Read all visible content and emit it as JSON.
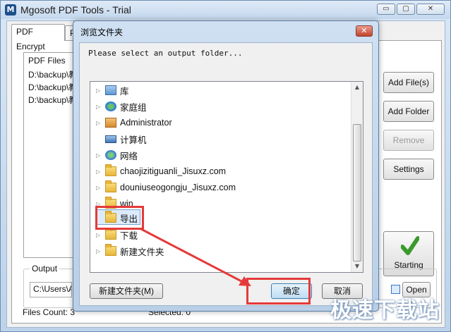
{
  "window": {
    "title": "Mgosoft PDF Tools - Trial",
    "controls": {
      "minimize": "▭",
      "restore": "▢",
      "close": "✕"
    }
  },
  "tabs": [
    "PDF Encrypt",
    "PDF"
  ],
  "file_list": {
    "header": "PDF Files",
    "rows": [
      "D:\\backup\\教",
      "D:\\backup\\教",
      "D:\\backup\\教"
    ]
  },
  "side_buttons": {
    "add_files": "Add File(s)",
    "add_folder": "Add Folder",
    "remove": "Remove",
    "settings": "Settings",
    "starting": "Starting"
  },
  "output": {
    "legend": "Output",
    "path": "C:\\Users\\A",
    "open": "Open"
  },
  "status": {
    "files_count": "Files Count: 3",
    "selected": "Selected: 0"
  },
  "dialog": {
    "title": "浏览文件夹",
    "close": "✕",
    "prompt": "Please select an output folder...",
    "tree": [
      {
        "label": "库",
        "icon": "library-icon",
        "expander": "▷"
      },
      {
        "label": "家庭组",
        "icon": "homegroup-icon",
        "expander": "▷"
      },
      {
        "label": "Administrator",
        "icon": "user-icon",
        "expander": "▷"
      },
      {
        "label": "计算机",
        "icon": "computer-icon",
        "expander": ""
      },
      {
        "label": "网络",
        "icon": "network-icon",
        "expander": "▷"
      },
      {
        "label": "chaojizitiguanli_Jisuxz.com",
        "icon": "folder-icon",
        "expander": "▷"
      },
      {
        "label": "douniuseogongju_Jisuxz.com",
        "icon": "folder-icon",
        "expander": "▷"
      },
      {
        "label": "win",
        "icon": "folder-icon",
        "expander": "▷"
      },
      {
        "label": "导出",
        "icon": "folder-icon",
        "expander": ""
      },
      {
        "label": "下载",
        "icon": "folder-icon",
        "expander": "▷"
      },
      {
        "label": "新建文件夹",
        "icon": "folder-icon",
        "expander": "▷"
      }
    ],
    "buttons": {
      "new_folder": "新建文件夹(M)",
      "ok": "确定",
      "cancel": "取消"
    }
  },
  "watermark": "极速下载站",
  "colors": {
    "highlight": "#e53a3a",
    "selection": "#dcebfc"
  }
}
